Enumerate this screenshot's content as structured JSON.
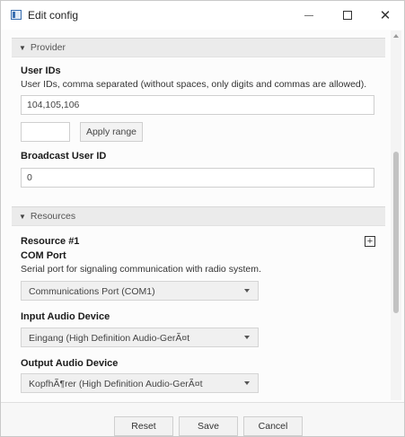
{
  "window": {
    "title": "Edit config"
  },
  "provider": {
    "header": "Provider",
    "user_ids": {
      "label": "User IDs",
      "description": "User IDs, comma separated (without spaces, only digits and commas are allowed).",
      "value": "104,105,106"
    },
    "range_value": "",
    "apply_range_label": "Apply range",
    "broadcast": {
      "label": "Broadcast User ID",
      "value": "0"
    }
  },
  "resources": {
    "header": "Resources",
    "resource_title": "Resource #1",
    "com_port": {
      "label": "COM Port",
      "description": "Serial port for signaling communication with radio system.",
      "selected": "Communications Port (COM1)"
    },
    "input_audio": {
      "label": "Input Audio Device",
      "selected": "Eingang (High Definition Audio-GerÃ¤t"
    },
    "output_audio": {
      "label": "Output Audio Device",
      "selected": "KopfhÃ¶rer (High Definition Audio-GerÃ¤t"
    }
  },
  "footer": {
    "reset_label": "Reset",
    "save_label": "Save",
    "cancel_label": "Cancel"
  },
  "icons": {
    "app": "app-window-icon",
    "minimize": "minimize-icon",
    "maximize": "maximize-icon",
    "close": "close-icon",
    "collapse": "triangle-down-icon",
    "add": "plus-box-icon"
  }
}
